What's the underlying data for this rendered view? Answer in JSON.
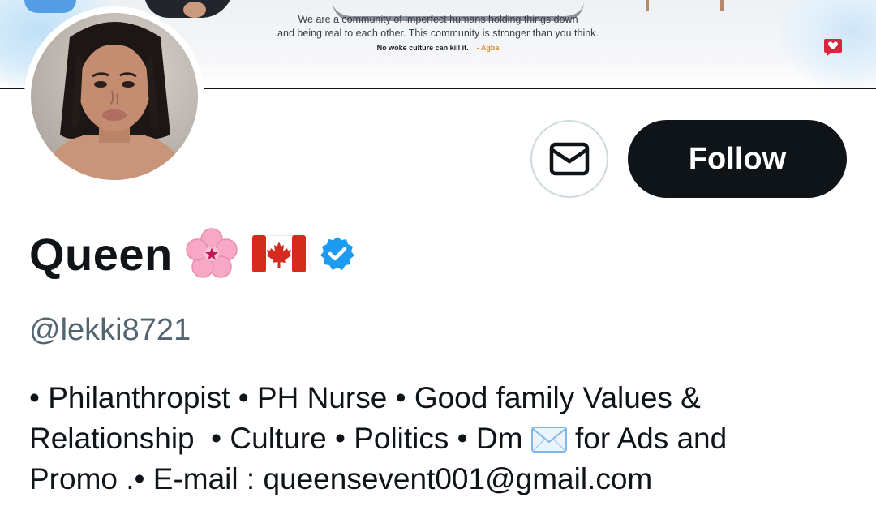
{
  "banner": {
    "quote_line1": "We are a community of imperfect humans holding things down",
    "quote_line2": "and being real to each other. This community is stronger than you think.",
    "tagline": "No woke culture can kill it.",
    "author": "- Agba",
    "accent_color": "#e08a2a"
  },
  "profile": {
    "avatar_alt": "profile photo",
    "display_name": "Queen",
    "name_emojis": [
      "cherry-blossom-icon",
      "canada-flag-icon",
      "verified-badge-icon"
    ],
    "handle": "@lekki8721",
    "bio_lines": {
      "line1": "• Philanthropist • PH Nurse • Good family Values &",
      "line2_a": "Relationship  • Culture • Politics • Dm ",
      "line2_b": " for Ads and",
      "line3": "Promo .• E-mail : queensevent001@gmail.com"
    }
  },
  "actions": {
    "message_icon": "envelope-icon",
    "follow_label": "Follow"
  },
  "colors": {
    "primary_text": "#0f1419",
    "secondary_text": "#536471",
    "verified_blue": "#1d9bf0",
    "follow_bg": "#0f1419"
  }
}
